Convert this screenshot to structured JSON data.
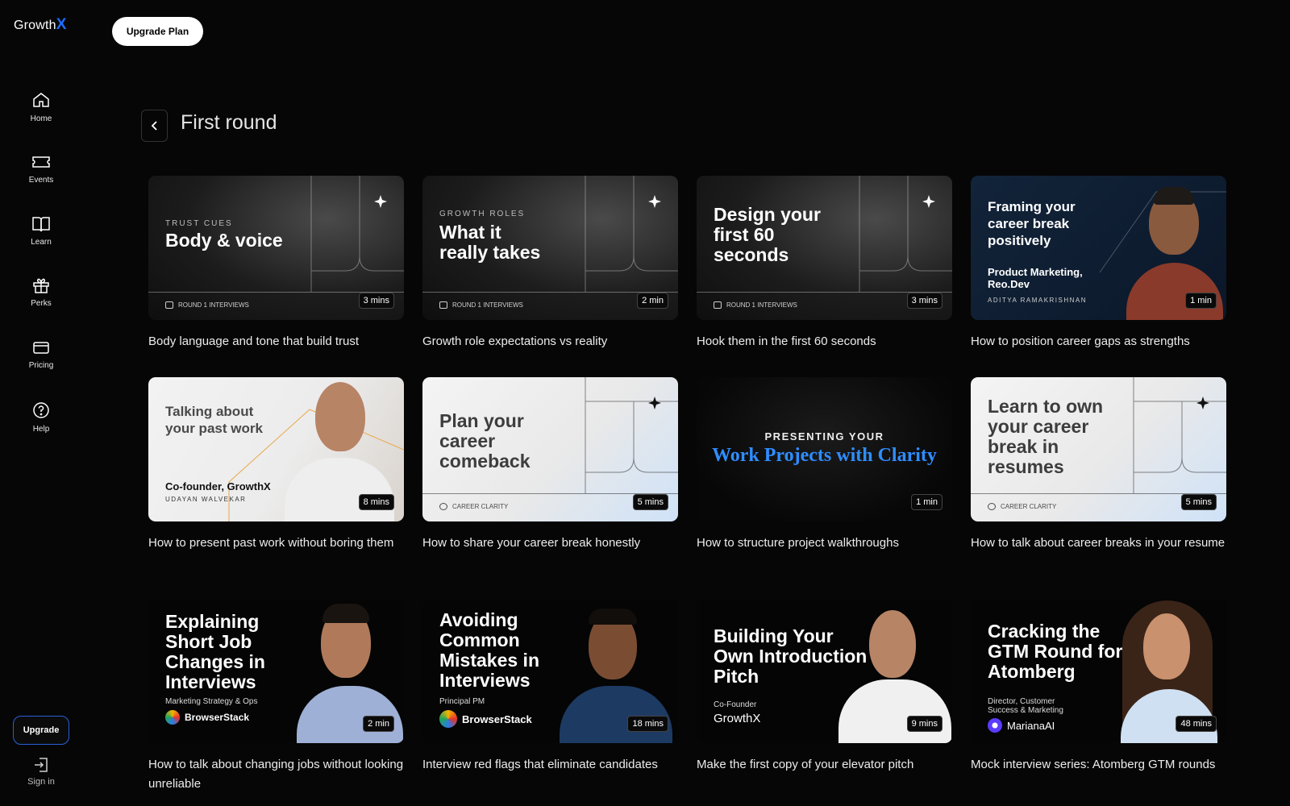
{
  "app": {
    "logo_text": "Growth",
    "logo_accent": "X",
    "upgrade_plan_label": "Upgrade Plan"
  },
  "sidebar": {
    "items": [
      {
        "label": "Home",
        "icon": "home-icon"
      },
      {
        "label": "Events",
        "icon": "ticket-icon"
      },
      {
        "label": "Learn",
        "icon": "book-icon"
      },
      {
        "label": "Perks",
        "icon": "gift-icon"
      },
      {
        "label": "Pricing",
        "icon": "card-icon"
      },
      {
        "label": "Help",
        "icon": "help-icon"
      }
    ],
    "upgrade_label": "Upgrade",
    "signin_label": "Sign in"
  },
  "page": {
    "title": "First round"
  },
  "cards": [
    {
      "title": "Body language and tone that build trust",
      "duration": "3 mins",
      "thumb": {
        "eyebrow": "TRUST CUES",
        "headline": "Body & voice",
        "tag": "ROUND 1 INTERVIEWS"
      }
    },
    {
      "title": "Growth role expectations vs reality",
      "duration": "2 min",
      "thumb": {
        "eyebrow": "GROWTH ROLES",
        "headline": "What it really takes",
        "tag": "ROUND 1 INTERVIEWS"
      }
    },
    {
      "title": "Hook them in the first 60 seconds",
      "duration": "3 mins",
      "thumb": {
        "headline": "Design your first 60 seconds",
        "tag": "ROUND 1 INTERVIEWS"
      }
    },
    {
      "title": "How to position career gaps as strengths",
      "duration": "1 min",
      "thumb": {
        "headline": "Framing your career break positively",
        "subhead": "Product Marketing, Reo.Dev",
        "person": "ADITYA RAMAKRISHNAN"
      }
    },
    {
      "title": "How to present past work without boring them",
      "duration": "8 mins",
      "thumb": {
        "headline": "Talking about your past work",
        "subhead": "Co-founder, GrowthX",
        "person": "UDAYAN WALVEKAR"
      }
    },
    {
      "title": "How to share your career break honestly",
      "duration": "5 mins",
      "thumb": {
        "headline": "Plan your career comeback",
        "tag": "CAREER CLARITY"
      }
    },
    {
      "title": "How to structure project walkthroughs",
      "duration": "1 min",
      "thumb": {
        "eyebrow": "PRESENTING YOUR",
        "headline": "Work Projects with Clarity"
      }
    },
    {
      "title": "How to talk about career breaks in your resume",
      "duration": "5 mins",
      "thumb": {
        "headline": "Learn to own your career break in resumes",
        "tag": "CAREER CLARITY"
      }
    },
    {
      "title": "How to talk about changing jobs without looking unreliable",
      "duration": "2 min",
      "thumb": {
        "headline": "Explaining Short Job Changes in Interviews",
        "role": "Marketing Strategy & Ops",
        "brand": "BrowserStack"
      }
    },
    {
      "title": "Interview red flags that eliminate candidates",
      "duration": "18 mins",
      "thumb": {
        "headline": "Avoiding Common Mistakes in Interviews",
        "role": "Principal PM",
        "brand": "BrowserStack"
      }
    },
    {
      "title": "Make the first copy of your elevator pitch",
      "duration": "9 mins",
      "thumb": {
        "headline": "Building Your Own Introduction Pitch",
        "role": "Co-Founder",
        "brand": "GrowthX"
      }
    },
    {
      "title": "Mock interview series: Atomberg GTM rounds",
      "duration": "48 mins",
      "thumb": {
        "headline": "Cracking the GTM Round for Atomberg",
        "role": "Director, Customer Success & Marketing",
        "brand": "MarianaAI"
      }
    }
  ],
  "colors": {
    "accent": "#1f6cff",
    "background": "#060606"
  }
}
